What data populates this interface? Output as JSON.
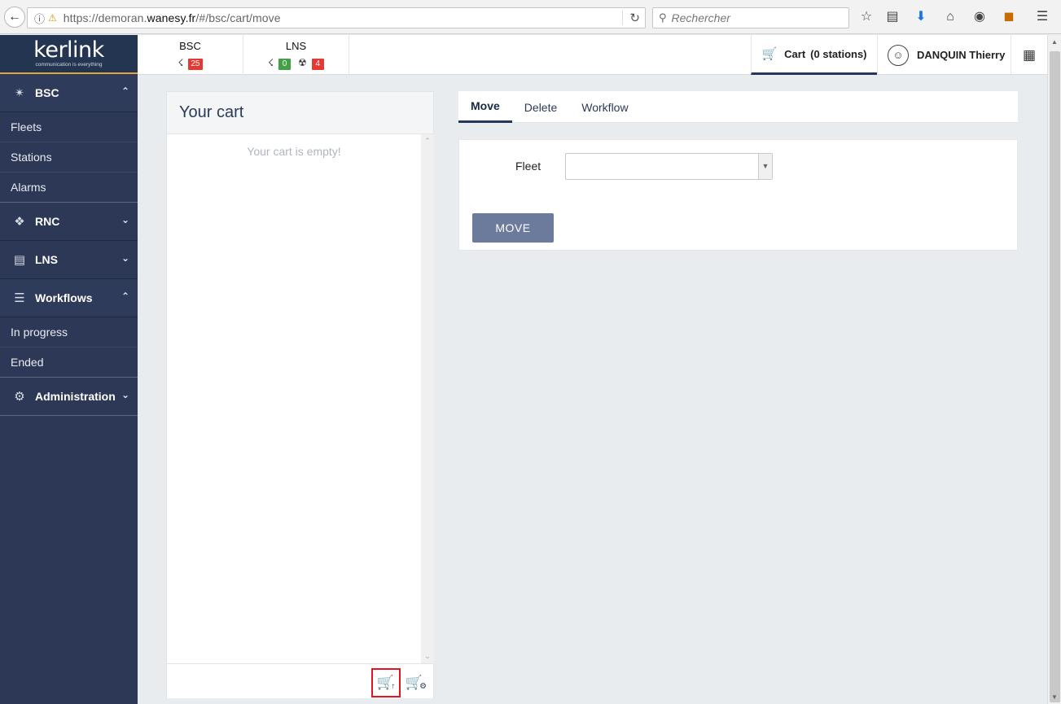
{
  "browser": {
    "url_prefix": "https://demoran.",
    "url_host": "wanesy.fr",
    "url_path": "/#/bsc/cart/move",
    "search_placeholder": "Rechercher"
  },
  "sidebar": {
    "logo_name": "kerlink",
    "logo_tagline": "communication is everything",
    "groups": [
      {
        "label": "BSC",
        "items": [
          "Fleets",
          "Stations",
          "Alarms"
        ]
      },
      {
        "label": "RNC",
        "items": []
      },
      {
        "label": "LNS",
        "items": []
      },
      {
        "label": "Workflows",
        "items": [
          "In progress",
          "Ended"
        ]
      },
      {
        "label": "Administration",
        "items": []
      }
    ]
  },
  "header": {
    "bsc": {
      "title": "BSC",
      "count": "25"
    },
    "lns": {
      "title": "LNS",
      "count_ok": "0",
      "count_alert": "4"
    },
    "cart_label": "Cart",
    "cart_count": "(0 stations)",
    "user_name": "DANQUIN Thierry"
  },
  "cart": {
    "title": "Your cart",
    "empty_message": "Your cart is empty!"
  },
  "tabs": [
    {
      "label": "Move",
      "active": true
    },
    {
      "label": "Delete",
      "active": false
    },
    {
      "label": "Workflow",
      "active": false
    }
  ],
  "form": {
    "fleet_label": "Fleet",
    "fleet_value": "",
    "move_button": "MOVE"
  },
  "colors": {
    "sidebar_bg": "#2c3856",
    "accent": "#25375f",
    "badge_red": "#e53935",
    "badge_green": "#43a047",
    "move_button": "#6c7b9b",
    "highlight": "#e3141f"
  }
}
